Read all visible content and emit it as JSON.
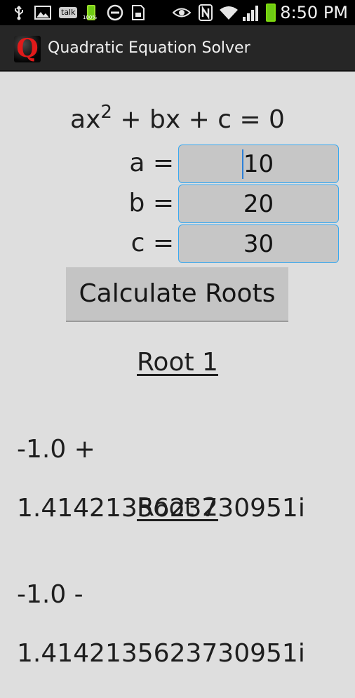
{
  "status_bar": {
    "talk_label": "talk",
    "battery_small_label": "100%",
    "time": "8:50 PM"
  },
  "app": {
    "logo_letter": "Q",
    "title": "Quadratic Equation Solver"
  },
  "equation": {
    "prefix": "ax",
    "exponent": "2",
    "suffix": " + bx + c = 0"
  },
  "inputs": [
    {
      "label": "a =",
      "value": "10"
    },
    {
      "label": "b =",
      "value": "20"
    },
    {
      "label": "c =",
      "value": "30"
    }
  ],
  "calculate_button": "Calculate Roots",
  "roots": [
    {
      "heading": "Root 1",
      "value_line1": "-1.0 +",
      "value_line2": "1.4142135623730951i"
    },
    {
      "heading": "Root 2",
      "value_line1": "-1.0 -",
      "value_line2": "1.4142135623730951i"
    }
  ],
  "colors": {
    "background": "#dedede",
    "field_border": "#38a8f0",
    "logo_letter": "#e11a1a"
  },
  "icons": [
    "usb-icon",
    "image-icon",
    "talk-icon",
    "battery-icon",
    "do-not-disturb-icon",
    "sd-card-icon",
    "eye-icon",
    "nfc-icon",
    "wifi-icon",
    "signal-icon",
    "battery-icon"
  ]
}
